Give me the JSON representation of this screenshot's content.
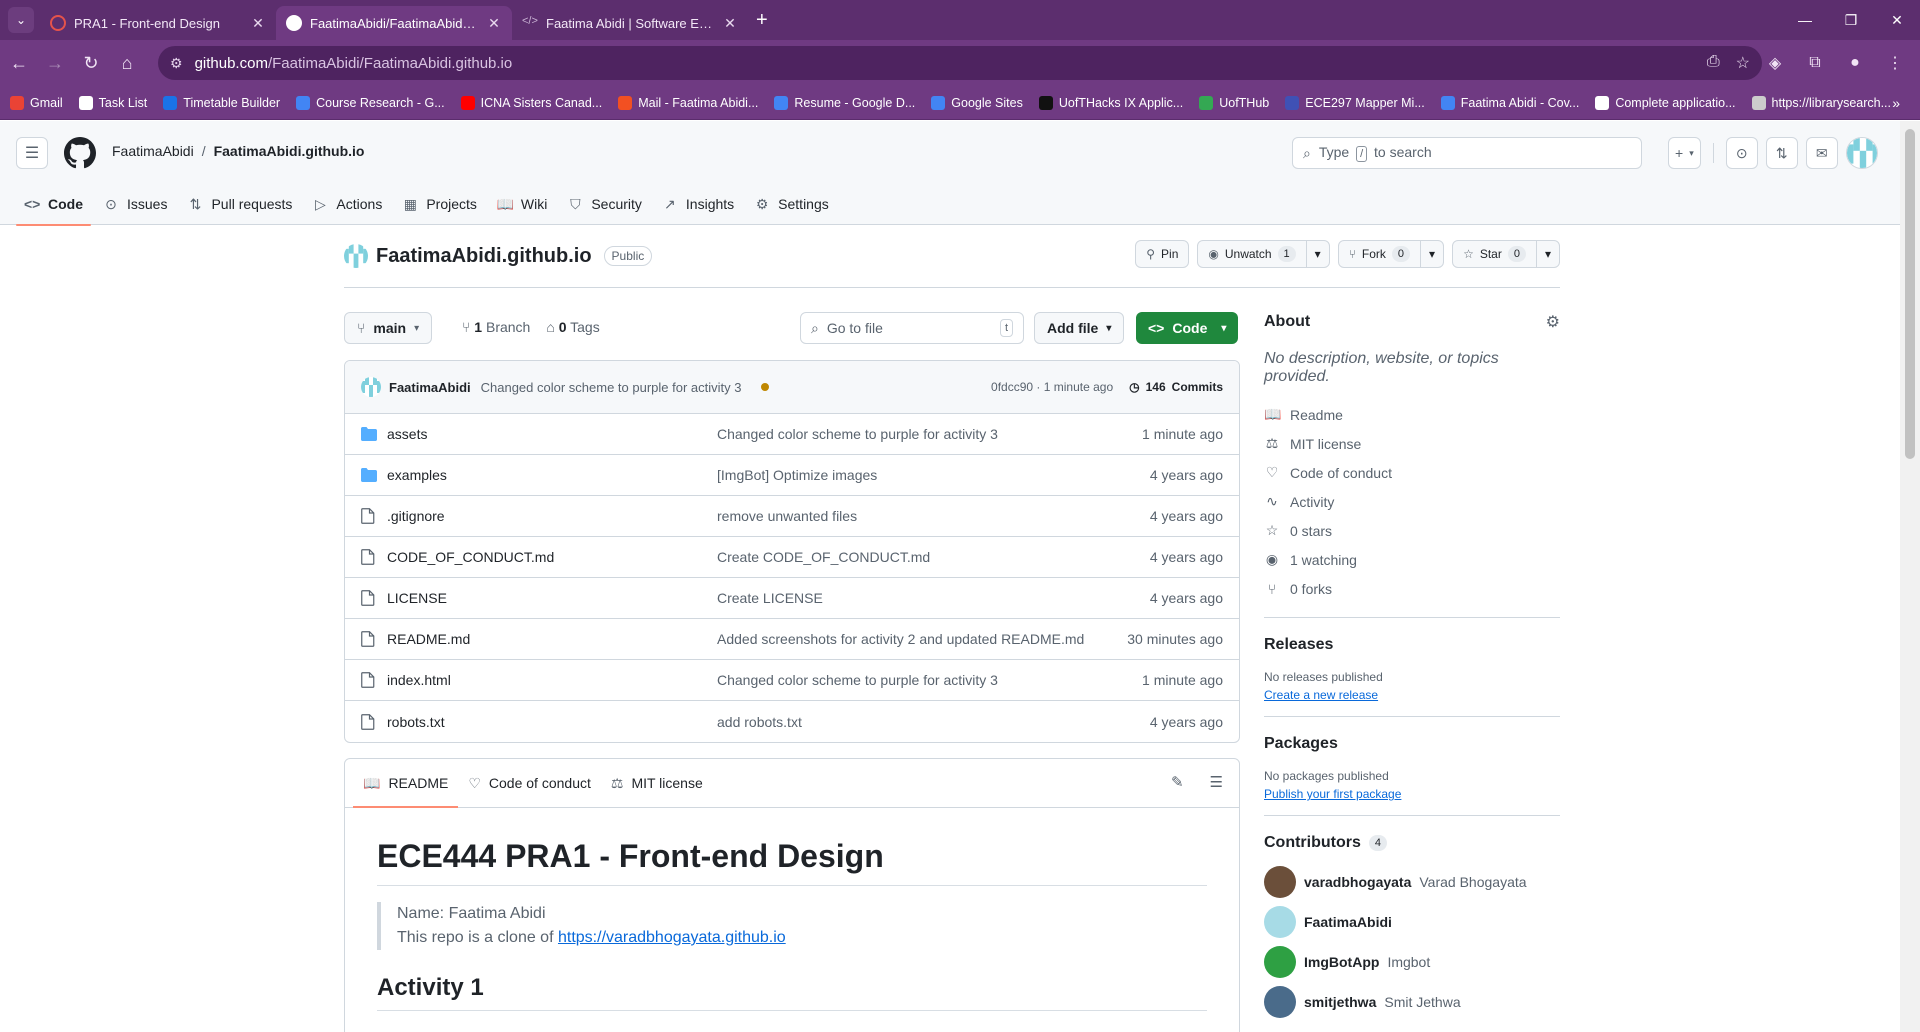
{
  "browser": {
    "tabs": [
      {
        "title": "PRA1 - Front-end Design",
        "active": false,
        "favicon_color": "#e5534b"
      },
      {
        "title": "FaatimaAbidi/FaatimaAbidi.githu",
        "active": true,
        "favicon_color": "#ffffff"
      },
      {
        "title": "Faatima Abidi | Software Engine",
        "active": false,
        "favicon_color": "#b9a4c4"
      }
    ],
    "new_tab": "+",
    "url_host": "github.com",
    "url_path": "/FaatimaAbidi/FaatimaAbidi.github.io",
    "bookmarks": [
      {
        "label": "Gmail",
        "color": "#ea4335"
      },
      {
        "label": "Task List",
        "color": "#ffffff"
      },
      {
        "label": "Timetable Builder",
        "color": "#1a73e8"
      },
      {
        "label": "Course Research - G...",
        "color": "#4285f4"
      },
      {
        "label": "ICNA Sisters Canad...",
        "color": "#ff0000"
      },
      {
        "label": "Mail - Faatima Abidi...",
        "color": "#f25022"
      },
      {
        "label": "Resume - Google D...",
        "color": "#4285f4"
      },
      {
        "label": "Google Sites",
        "color": "#4285f4"
      },
      {
        "label": "UofTHacks IX Applic...",
        "color": "#111111"
      },
      {
        "label": "UofTHub",
        "color": "#34a853"
      },
      {
        "label": "ECE297 Mapper Mi...",
        "color": "#3f51b5"
      },
      {
        "label": "Faatima Abidi - Cov...",
        "color": "#4285f4"
      },
      {
        "label": "Complete applicatio...",
        "color": "#ffffff"
      },
      {
        "label": "https://librarysearch...",
        "color": "#cccccc"
      }
    ],
    "bookmarks_more": "»"
  },
  "header": {
    "owner": "FaatimaAbidi",
    "separator": "/",
    "repo": "FaatimaAbidi.github.io",
    "search_prefix": "Type",
    "search_key": "/",
    "search_suffix": "to search"
  },
  "repo_nav": [
    {
      "label": "Code",
      "icon": "code-icon",
      "glyph": "<>",
      "active": true
    },
    {
      "label": "Issues",
      "icon": "issue-icon",
      "glyph": "⊙",
      "active": false
    },
    {
      "label": "Pull requests",
      "icon": "pull-request-icon",
      "glyph": "⇅",
      "active": false
    },
    {
      "label": "Actions",
      "icon": "play-icon",
      "glyph": "▷",
      "active": false
    },
    {
      "label": "Projects",
      "icon": "table-icon",
      "glyph": "▦",
      "active": false
    },
    {
      "label": "Wiki",
      "icon": "book-icon",
      "glyph": "📖",
      "active": false
    },
    {
      "label": "Security",
      "icon": "shield-icon",
      "glyph": "⛉",
      "active": false
    },
    {
      "label": "Insights",
      "icon": "graph-icon",
      "glyph": "↗",
      "active": false
    },
    {
      "label": "Settings",
      "icon": "gear-icon",
      "glyph": "⚙",
      "active": false
    }
  ],
  "repo": {
    "name": "FaatimaAbidi.github.io",
    "visibility": "Public",
    "pin_label": "Pin",
    "watch_label": "Unwatch",
    "watch_count": "1",
    "fork_label": "Fork",
    "fork_count": "0",
    "star_label": "Star",
    "star_count": "0"
  },
  "browser_bar": {
    "branch": "main",
    "branches_count": "1",
    "branches_label": "Branch",
    "tags_count": "0",
    "tags_label": "Tags",
    "go_to_file_placeholder": "Go to file",
    "go_to_file_key": "t",
    "add_file_label": "Add file",
    "code_label": "Code"
  },
  "latest_commit": {
    "author": "FaatimaAbidi",
    "message": "Changed color scheme to purple for activity 3",
    "hash": "0fdcc90",
    "sep": "·",
    "time": "1 minute ago",
    "commits_count": "146",
    "commits_label": "Commits"
  },
  "files": [
    {
      "name": "assets",
      "type": "dir",
      "message": "Changed color scheme to purple for activity 3",
      "date": "1 minute ago"
    },
    {
      "name": "examples",
      "type": "dir",
      "message": "[ImgBot] Optimize images",
      "date": "4 years ago"
    },
    {
      "name": ".gitignore",
      "type": "file",
      "message": "remove unwanted files",
      "date": "4 years ago"
    },
    {
      "name": "CODE_OF_CONDUCT.md",
      "type": "file",
      "message": "Create CODE_OF_CONDUCT.md",
      "date": "4 years ago"
    },
    {
      "name": "LICENSE",
      "type": "file",
      "message": "Create LICENSE",
      "date": "4 years ago"
    },
    {
      "name": "README.md",
      "type": "file",
      "message": "Added screenshots for activity 2 and updated README.md",
      "date": "30 minutes ago"
    },
    {
      "name": "index.html",
      "type": "file",
      "message": "Changed color scheme to purple for activity 3",
      "date": "1 minute ago"
    },
    {
      "name": "robots.txt",
      "type": "file",
      "message": "add robots.txt",
      "date": "4 years ago"
    }
  ],
  "readme": {
    "tabs": [
      {
        "label": "README",
        "icon": "book-icon",
        "glyph": "📖",
        "active": true
      },
      {
        "label": "Code of conduct",
        "icon": "code-of-conduct-icon",
        "glyph": "♡",
        "active": false
      },
      {
        "label": "MIT license",
        "icon": "law-icon",
        "glyph": "⚖",
        "active": false
      }
    ],
    "title": "ECE444 PRA1 - Front-end Design",
    "quote_line1": "Name: Faatima Abidi",
    "quote_line2_prefix": "This repo is a clone of",
    "quote_link": "https://varadbhogayata.github.io",
    "h2": "Activity 1"
  },
  "about": {
    "heading": "About",
    "description": "No description, website, or topics provided.",
    "items": [
      {
        "label": "Readme",
        "icon": "book-icon",
        "glyph": "📖"
      },
      {
        "label": "MIT license",
        "icon": "law-icon",
        "glyph": "⚖"
      },
      {
        "label": "Code of conduct",
        "icon": "code-of-conduct-icon",
        "glyph": "♡"
      },
      {
        "label": "Activity",
        "icon": "pulse-icon",
        "glyph": "∿"
      },
      {
        "label": "0 stars",
        "icon": "star-icon",
        "glyph": "☆"
      },
      {
        "label": "1 watching",
        "icon": "eye-icon",
        "glyph": "◉"
      },
      {
        "label": "0 forks",
        "icon": "fork-icon",
        "glyph": "⑂"
      }
    ]
  },
  "releases": {
    "heading": "Releases",
    "none_text": "No releases published",
    "link": "Create a new release"
  },
  "packages": {
    "heading": "Packages",
    "none_text": "No packages published",
    "link": "Publish your first package"
  },
  "contributors": {
    "heading": "Contributors",
    "count": "4",
    "people": [
      {
        "login": "varadbhogayata",
        "name": "Varad Bhogayata",
        "color": "#6b4f3a"
      },
      {
        "login": "FaatimaAbidi",
        "name": "",
        "color": "#a7dbe6"
      },
      {
        "login": "ImgBotApp",
        "name": "Imgbot",
        "color": "#2ea043"
      },
      {
        "login": "smitjethwa",
        "name": "Smit Jethwa",
        "color": "#4a6b8a"
      }
    ]
  }
}
